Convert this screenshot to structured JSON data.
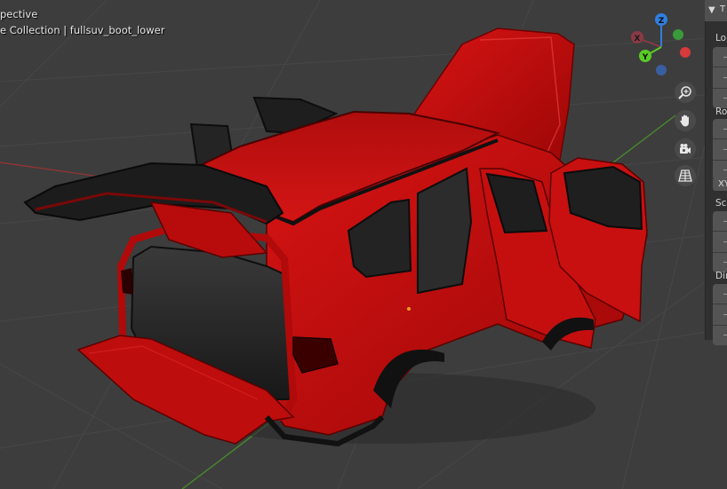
{
  "viewport": {
    "view_name": "pective",
    "collection_path": "e Collection | fullsuv_boot_lower",
    "background_color": "#3d3d3d",
    "grid_line_color": "#494949",
    "x_axis_color": "#9b3a3a",
    "y_axis_color": "#4f8a31",
    "object_color": "#c20c0c"
  },
  "gizmo": {
    "axes": [
      {
        "label": "Z",
        "color": "#2f7fe0"
      },
      {
        "label": "X",
        "color": "#8a3a45"
      },
      {
        "label": "Y",
        "color": "#59cc26"
      }
    ],
    "negative_colors": [
      "#d63a3a",
      "#3a9a3a",
      "#3a5fa0"
    ]
  },
  "nav_buttons": [
    {
      "name": "zoom-icon"
    },
    {
      "name": "hand-icon"
    },
    {
      "name": "camera-icon"
    },
    {
      "name": "grid-icon"
    }
  ],
  "side_panel": {
    "tab_arrow": "▼",
    "tab_text": "T",
    "sections": [
      {
        "label": "Lo"
      },
      {
        "label": "Ro"
      },
      {
        "label": "Sc"
      },
      {
        "label": "Dir"
      }
    ],
    "mode_value": "XY"
  }
}
